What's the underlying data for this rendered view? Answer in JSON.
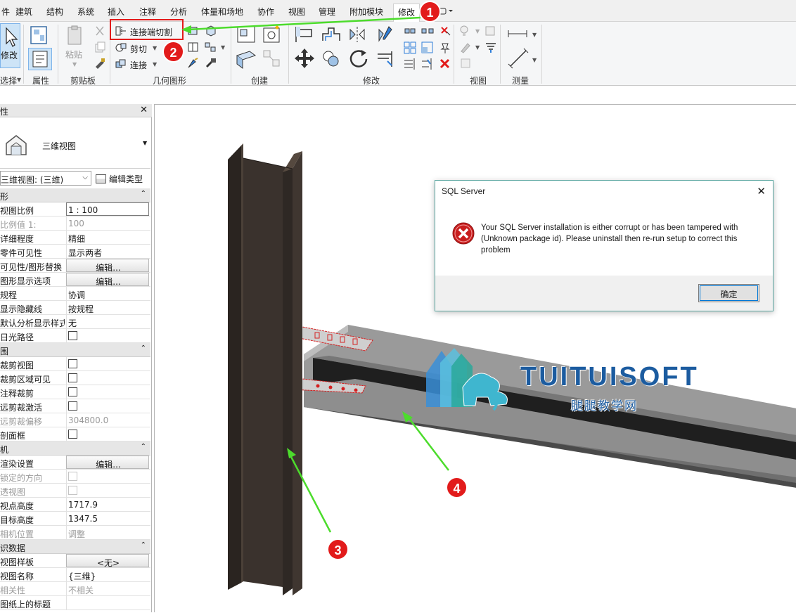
{
  "menu": {
    "items": [
      "件",
      "建筑",
      "结构",
      "系统",
      "插入",
      "注释",
      "分析",
      "体量和场地",
      "协作",
      "视图",
      "管理",
      "附加模块",
      "修改"
    ]
  },
  "ribbon": {
    "panels": {
      "select": "选择",
      "properties": "属性",
      "clipboard": "剪贴板",
      "geometry": "几何图形",
      "create": "创建",
      "modify": "修改",
      "view": "视图",
      "measure": "测量"
    },
    "modify_label": "修改",
    "paste_label": "粘贴",
    "connection_cut": "连接端切割",
    "cut": "剪切",
    "join": "连接"
  },
  "properties": {
    "title": "性",
    "type_name": "三维视图",
    "instance_select": "三维视图: (三维)",
    "edit_type": "编辑类型",
    "rows": [
      {
        "k": "形",
        "section": true
      },
      {
        "k": "视图比例",
        "v": "1 : 100",
        "style": "boxed"
      },
      {
        "k": "比例值 1:",
        "v": "100",
        "dim": true
      },
      {
        "k": "详细程度",
        "v": "精细"
      },
      {
        "k": "零件可见性",
        "v": "显示两者"
      },
      {
        "k": "可见性/图形替换",
        "v": "编辑...",
        "style": "btn"
      },
      {
        "k": "图形显示选项",
        "v": "编辑...",
        "style": "btn"
      },
      {
        "k": "规程",
        "v": "协调"
      },
      {
        "k": "显示隐藏线",
        "v": "按规程"
      },
      {
        "k": "默认分析显示样式",
        "v": "无"
      },
      {
        "k": "日光路径",
        "check": true
      },
      {
        "k": "围",
        "section": true
      },
      {
        "k": "裁剪视图",
        "check": true
      },
      {
        "k": "裁剪区域可见",
        "check": true
      },
      {
        "k": "注释裁剪",
        "check": true
      },
      {
        "k": "远剪裁激活",
        "check": true
      },
      {
        "k": "远剪裁偏移",
        "v": "304800.0",
        "dim": true
      },
      {
        "k": "剖面框",
        "check": true
      },
      {
        "k": "机",
        "section": true
      },
      {
        "k": "渲染设置",
        "v": "编辑...",
        "style": "btn"
      },
      {
        "k": "锁定的方向",
        "check": true,
        "dim": true
      },
      {
        "k": "透视图",
        "check": true,
        "dim": true
      },
      {
        "k": "视点高度",
        "v": "1717.9"
      },
      {
        "k": "目标高度",
        "v": "1347.5"
      },
      {
        "k": "相机位置",
        "v": "调整",
        "dim": true
      },
      {
        "k": "识数据",
        "section": true
      },
      {
        "k": "视图样板",
        "v": "<无>",
        "style": "btn"
      },
      {
        "k": "视图名称",
        "v": "{三维}"
      },
      {
        "k": "相关性",
        "v": "不相关",
        "dim": true
      },
      {
        "k": "图纸上的标题",
        "v": ""
      }
    ]
  },
  "dialog": {
    "title": "SQL Server",
    "message": "Your SQL Server installation is either corrupt or has been tampered with (Unknown package id).   Please uninstall then re-run setup to correct this problem",
    "ok": "确定"
  },
  "annotations": {
    "b1": "1",
    "b2": "2",
    "b3": "3",
    "b4": "4"
  },
  "watermark": {
    "brand": "TUITUISOFT",
    "sub": "腿腿教学网"
  },
  "colors": {
    "annotation_red": "#e21b1b",
    "arrow_green": "#4cdc2c",
    "column_dark": "#3a322d",
    "beam_gray": "#8a8a8a",
    "brand_blue": "#1c5ca0"
  }
}
